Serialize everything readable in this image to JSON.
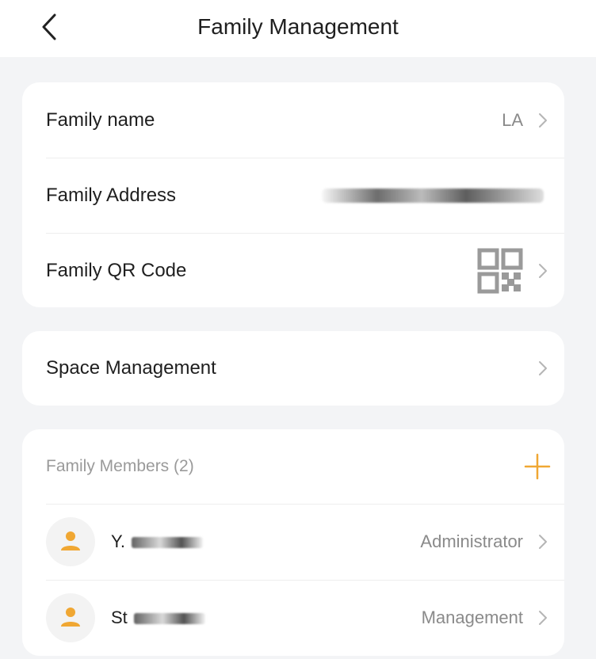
{
  "header": {
    "title": "Family Management"
  },
  "family_card": {
    "name_label": "Family name",
    "name_value": "LA",
    "address_label": "Family Address",
    "qr_label": "Family QR Code"
  },
  "space_card": {
    "label": "Space Management"
  },
  "members": {
    "title": "Family Members (2)",
    "items": [
      {
        "name": "Y.",
        "role": "Administrator"
      },
      {
        "name": "St",
        "role": "Management"
      }
    ]
  },
  "colors": {
    "accent": "#f0a733",
    "background": "#f3f4f6"
  },
  "icons": [
    "back-icon",
    "chevron-right-icon",
    "qr-code-icon",
    "plus-icon",
    "user-icon"
  ]
}
